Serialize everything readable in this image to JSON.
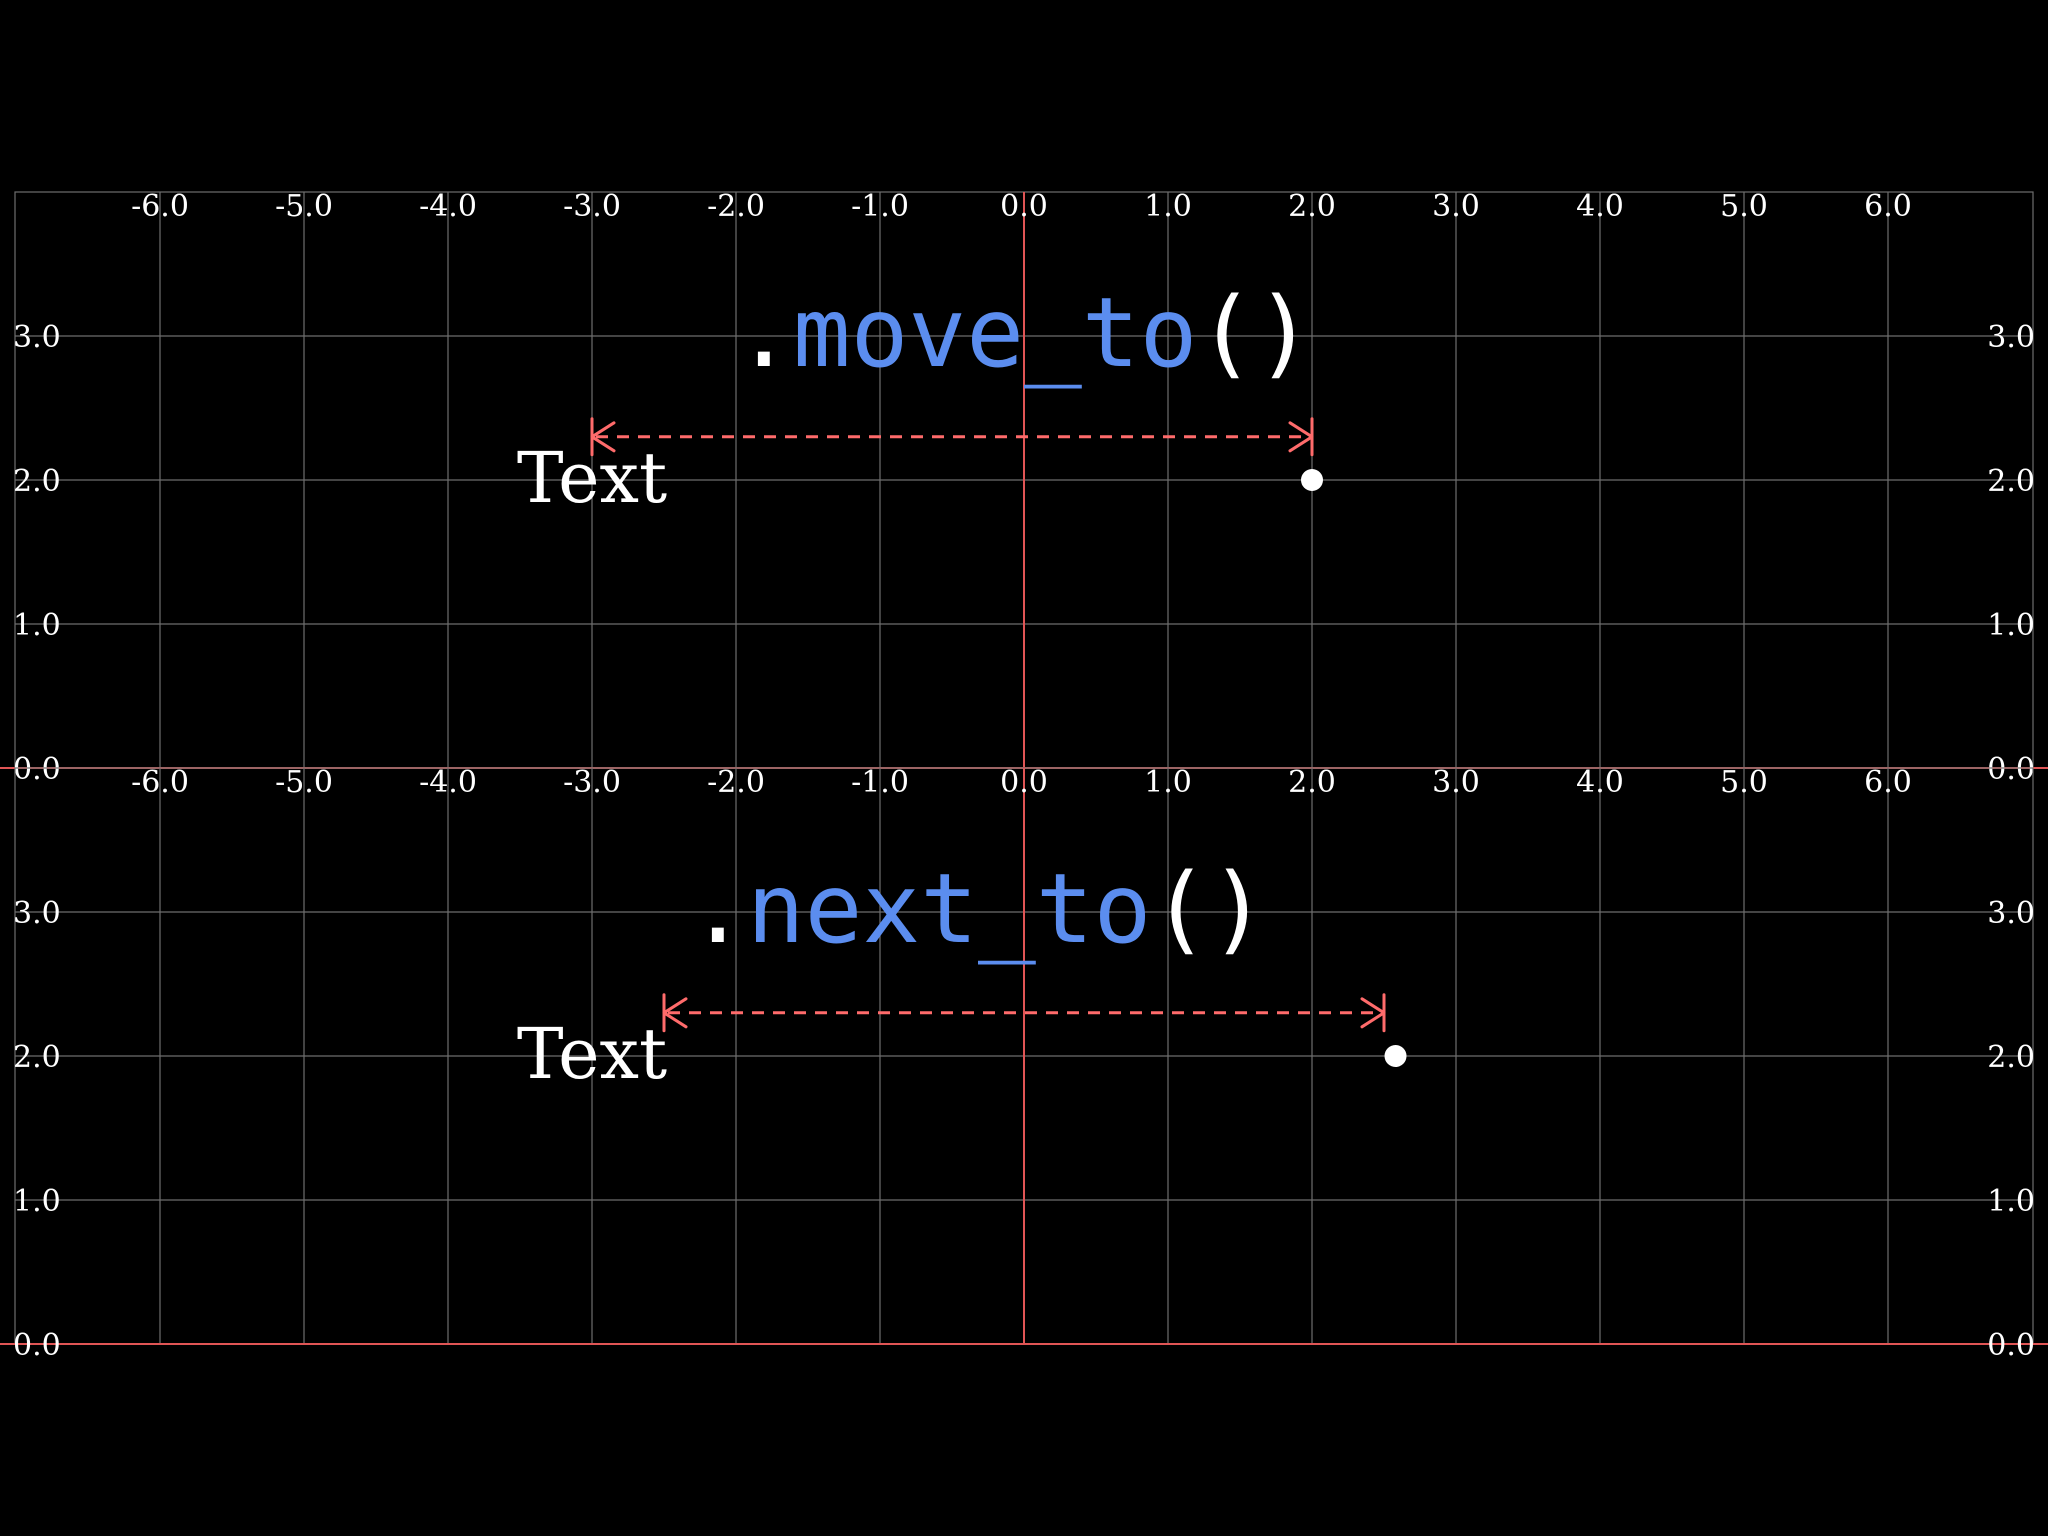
{
  "x_ticks": [
    "-6.0",
    "-5.0",
    "-4.0",
    "-3.0",
    "-2.0",
    "-1.0",
    "0.0",
    "1.0",
    "2.0",
    "3.0",
    "4.0",
    "5.0",
    "6.0"
  ],
  "y_ticks": [
    "3.0",
    "2.0",
    "1.0",
    "0.0"
  ],
  "colors": {
    "background": "#000000",
    "grid": "#6e6e6e",
    "axis": "#e05555",
    "method_name": "#5b8def",
    "arrow": "#ff6b6b",
    "text": "#ffffff"
  },
  "panels": [
    {
      "method": {
        "dot": ".",
        "name": "move_to",
        "parens": "()"
      },
      "object_label": "Text",
      "target_point": {
        "x": 2.0,
        "y": 2.0
      },
      "arrow": {
        "from_x": -3.0,
        "to_x": 2.0,
        "y": 2.3
      }
    },
    {
      "method": {
        "dot": ".",
        "name": "next_to",
        "parens": "()"
      },
      "object_label": "Text",
      "target_point": {
        "x": 2.58,
        "y": 2.0
      },
      "arrow": {
        "from_x": -2.5,
        "to_x": 2.5,
        "y": 2.3
      }
    }
  ]
}
